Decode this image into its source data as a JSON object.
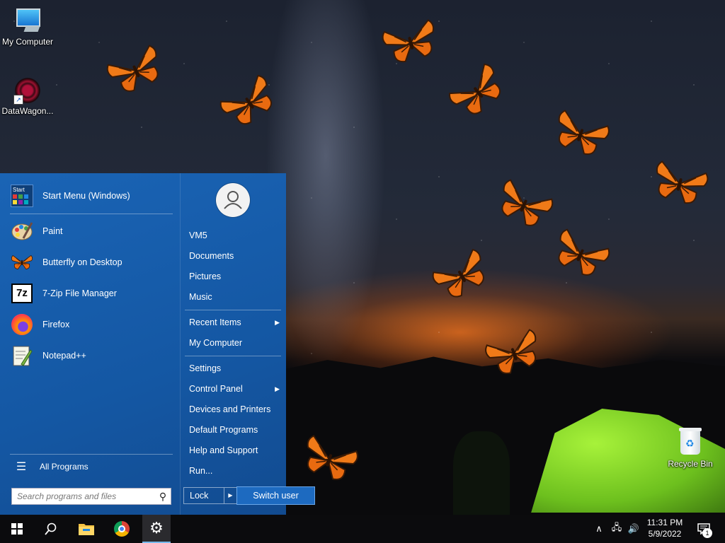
{
  "desktop": {
    "icons": [
      {
        "label": "My Computer",
        "icon": "computer-icon"
      },
      {
        "label": "DataWagon...",
        "icon": "datawagon-icon"
      },
      {
        "label": "Recycle Bin",
        "icon": "recycle-bin-icon"
      }
    ]
  },
  "start_menu": {
    "header_app": {
      "label": "Start Menu (Windows)",
      "icon": "start-menu-icon"
    },
    "apps": [
      {
        "label": "Paint",
        "icon": "paint-icon"
      },
      {
        "label": "Butterfly on Desktop",
        "icon": "butterfly-icon"
      },
      {
        "label": "7-Zip File Manager",
        "icon": "7zip-icon"
      },
      {
        "label": "Firefox",
        "icon": "firefox-icon"
      },
      {
        "label": "Notepad++",
        "icon": "notepadpp-icon"
      }
    ],
    "all_programs": "All Programs",
    "search_placeholder": "Search programs and files",
    "right": {
      "user": "VM5",
      "documents": "Documents",
      "pictures": "Pictures",
      "music": "Music",
      "recent_items": "Recent Items",
      "my_computer": "My Computer",
      "settings": "Settings",
      "control_panel": "Control Panel",
      "devices_printers": "Devices and Printers",
      "default_programs": "Default Programs",
      "help_support": "Help and Support",
      "run": "Run..."
    },
    "lock": "Lock",
    "switch_user": "Switch user"
  },
  "taskbar": {
    "items": [
      "windows-start-icon",
      "search-icon",
      "file-explorer-icon",
      "chrome-icon",
      "settings-icon"
    ],
    "active": "settings-icon",
    "clock_time": "11:31 PM",
    "clock_date": "5/9/2022",
    "notification_count": "1"
  },
  "colors": {
    "start_menu_bg": "#1457a3",
    "taskbar_bg": "#0b0b0d",
    "tent": "#7ed321",
    "butterfly": "#f07a18"
  }
}
